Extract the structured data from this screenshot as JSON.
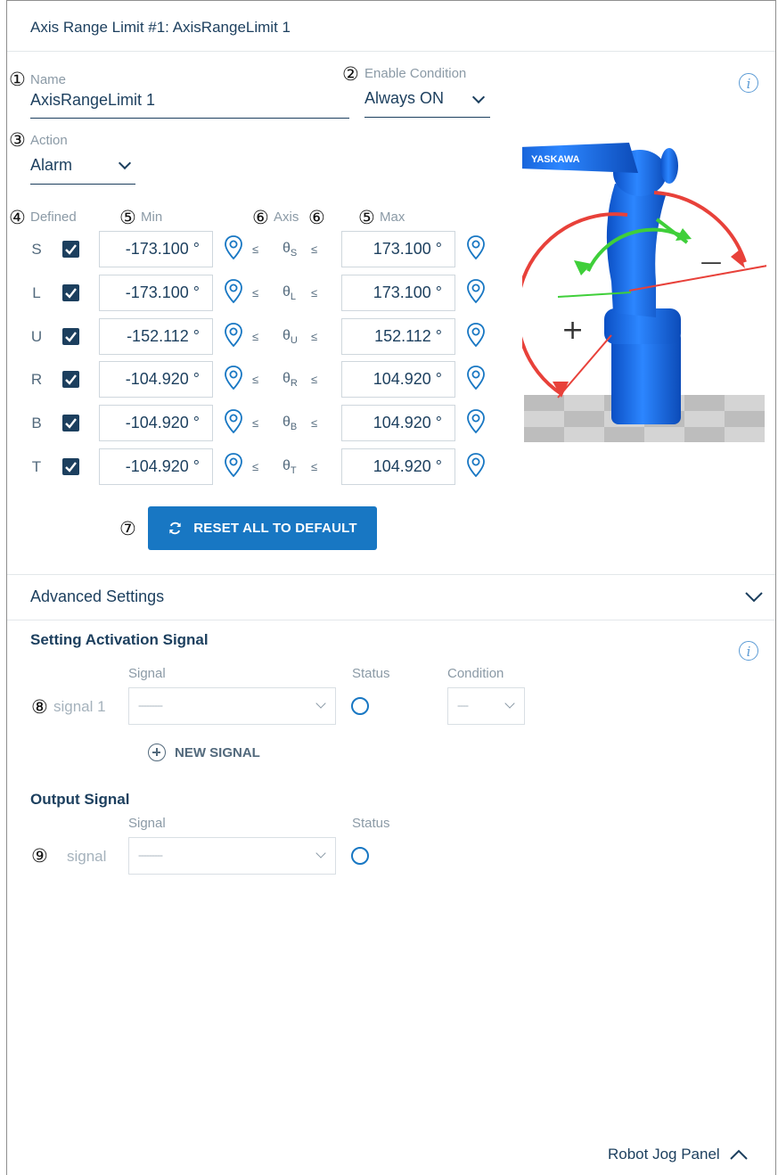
{
  "header": {
    "title": "Axis Range Limit #1: AxisRangeLimit 1"
  },
  "markers": [
    "①",
    "②",
    "③",
    "④",
    "⑤",
    "⑥",
    "⑦",
    "⑧",
    "⑨"
  ],
  "name_field": {
    "label": "Name",
    "value": "AxisRangeLimit 1"
  },
  "enable_condition": {
    "label": "Enable Condition",
    "value": "Always ON"
  },
  "action": {
    "label": "Action",
    "value": "Alarm"
  },
  "columns": {
    "defined": "Defined",
    "min": "Min",
    "axis": "Axis",
    "max": "Max"
  },
  "axes": [
    {
      "letter": "S",
      "sub": "S",
      "defined": true,
      "min": "-173.100 °",
      "max": "173.100 °"
    },
    {
      "letter": "L",
      "sub": "L",
      "defined": true,
      "min": "-173.100 °",
      "max": "173.100 °"
    },
    {
      "letter": "U",
      "sub": "U",
      "defined": true,
      "min": "-152.112 °",
      "max": "152.112 °"
    },
    {
      "letter": "R",
      "sub": "R",
      "defined": true,
      "min": "-104.920 °",
      "max": "104.920 °"
    },
    {
      "letter": "B",
      "sub": "B",
      "defined": true,
      "min": "-104.920 °",
      "max": "104.920 °"
    },
    {
      "letter": "T",
      "sub": "T",
      "defined": true,
      "min": "-104.920 °",
      "max": "104.920 °"
    }
  ],
  "symbols": {
    "le": "≤",
    "theta": "θ"
  },
  "robot": {
    "brand": "YASKAWA",
    "plus": "+",
    "minus": "—"
  },
  "reset_button": {
    "label": "RESET ALL TO DEFAULT"
  },
  "advanced": {
    "label": "Advanced Settings"
  },
  "activation": {
    "title": "Setting Activation Signal",
    "col_signal": "Signal",
    "col_status": "Status",
    "col_condition": "Condition",
    "row_label": "signal 1",
    "signal_value": "---------",
    "condition_value": "----",
    "new_signal": "NEW SIGNAL"
  },
  "output": {
    "title": "Output Signal",
    "col_signal": "Signal",
    "col_status": "Status",
    "row_label": "signal",
    "signal_value": "---------"
  },
  "jog_panel": {
    "label": "Robot Jog Panel"
  },
  "colors": {
    "primary": "#1877c3",
    "text": "#1c3f5e",
    "muted": "#8b9aa6",
    "red_arc": "#e8413a",
    "green_arc": "#3fcf3a",
    "robot": "#1f6fe0"
  }
}
